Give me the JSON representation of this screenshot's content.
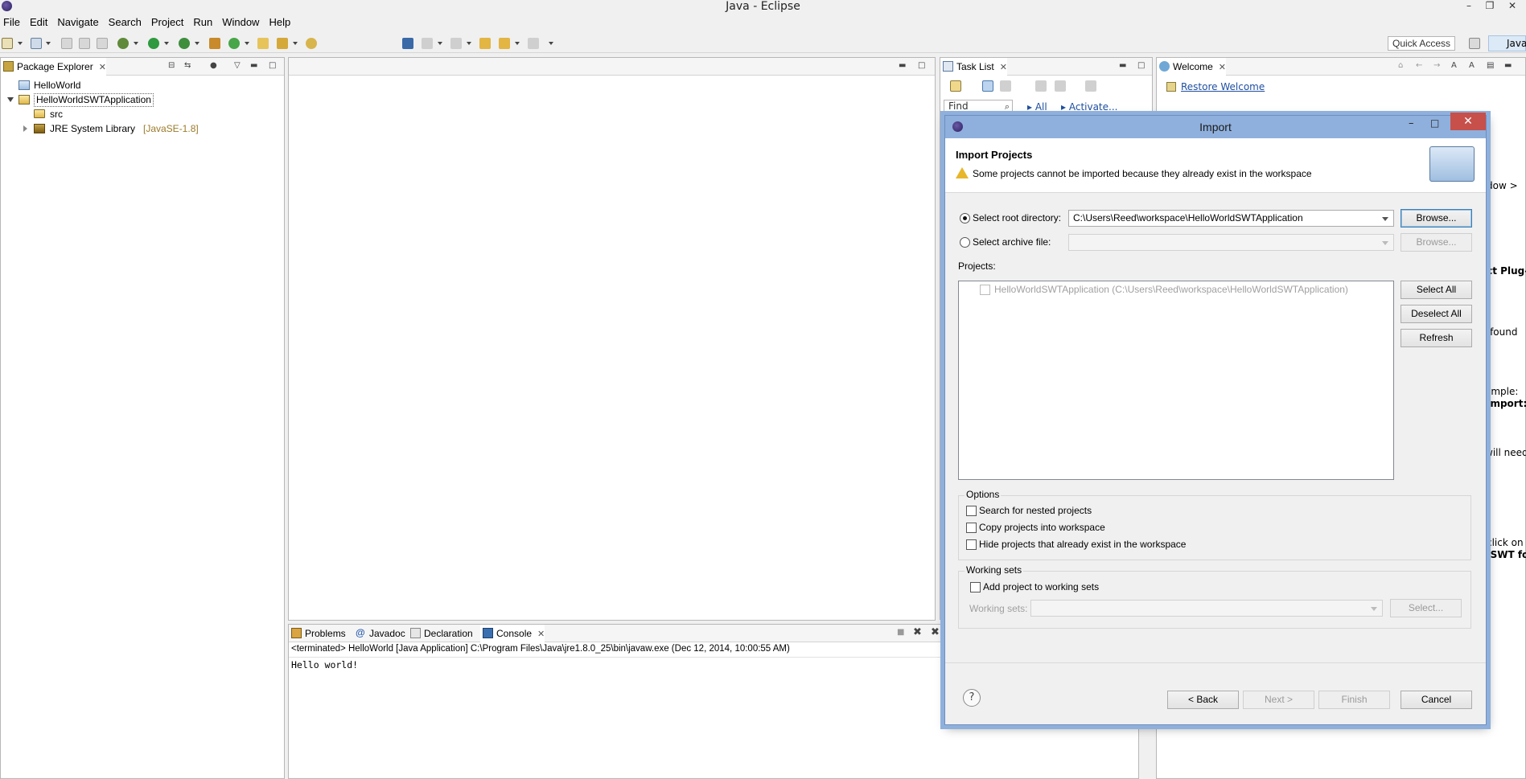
{
  "window": {
    "title": "Java - Eclipse"
  },
  "menu": [
    "File",
    "Edit",
    "Navigate",
    "Search",
    "Project",
    "Run",
    "Window",
    "Help"
  ],
  "toolbar": {
    "quick_access": "Quick Access",
    "perspective": "Java"
  },
  "package_explorer": {
    "tab": "Package Explorer",
    "items": [
      {
        "label": "HelloWorld"
      },
      {
        "label": "HelloWorldSWTApplication"
      },
      {
        "label": "src"
      },
      {
        "label": "JRE System Library",
        "suffix": "[JavaSE-1.8]"
      }
    ]
  },
  "task_list": {
    "tab": "Task List",
    "find": "Find",
    "all": "All",
    "activate": "Activate..."
  },
  "welcome": {
    "tab": "Welcome",
    "restore": "Restore Welcome",
    "fragments": [
      "dow >",
      "ect Plug-",
      "s found",
      "ample:",
      "Import:",
      "will need",
      "click on",
      "dSWT for"
    ]
  },
  "bottom_tabs": [
    "Problems",
    "Javadoc",
    "Declaration",
    "Console"
  ],
  "console": {
    "header": "<terminated> HelloWorld [Java Application] C:\\Program Files\\Java\\jre1.8.0_25\\bin\\javaw.exe (Dec 12, 2014, 10:00:55 AM)",
    "output": "Hello world!"
  },
  "dialog": {
    "title": "Import",
    "heading": "Import Projects",
    "warning": "Some projects cannot be imported because they already exist in the workspace",
    "root_dir_label": "Select root directory:",
    "root_dir_value": "C:\\Users\\Reed\\workspace\\HelloWorldSWTApplication",
    "archive_label": "Select archive file:",
    "browse": "Browse...",
    "projects_label": "Projects:",
    "project_entry": "HelloWorldSWTApplication (C:\\Users\\Reed\\workspace\\HelloWorldSWTApplication)",
    "select_all": "Select All",
    "deselect_all": "Deselect All",
    "refresh": "Refresh",
    "options_title": "Options",
    "opt_nested": "Search for nested projects",
    "opt_copy": "Copy projects into workspace",
    "opt_hide": "Hide projects that already exist in the workspace",
    "working_sets_title": "Working sets",
    "add_ws": "Add project to working sets",
    "ws_label": "Working sets:",
    "select": "Select...",
    "back": "< Back",
    "next": "Next >",
    "finish": "Finish",
    "cancel": "Cancel",
    "help": "?"
  }
}
